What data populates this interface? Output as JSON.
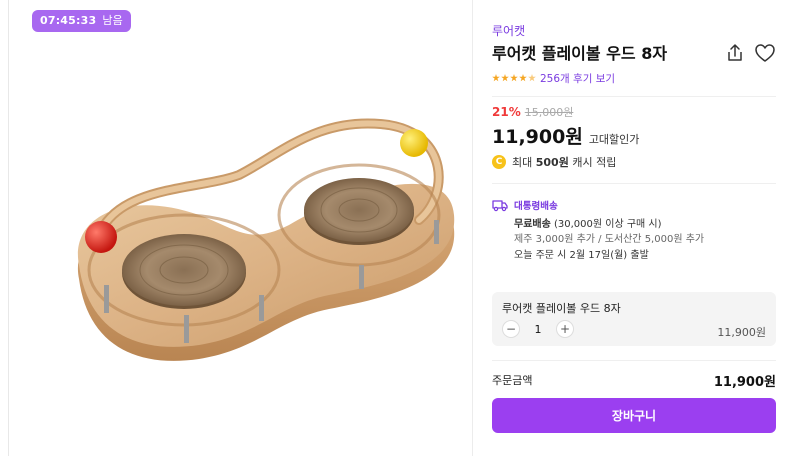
{
  "timer": {
    "time": "07:45:33",
    "suffix": "남음"
  },
  "product": {
    "brand": "루어캣",
    "title": "루어캣 플레이볼 우드 8자",
    "rating": 4.5,
    "review_text": "256개 후기 보기",
    "discount": "21%",
    "original_price": "15,000원",
    "price": "11,900원",
    "price_label": "고대할인가",
    "cash": {
      "prefix": "최대 ",
      "amount": "500원",
      "suffix": " 캐시 적립",
      "icon_char": "C"
    }
  },
  "shipping": {
    "header": "대통령배송",
    "line1_bold": "무료배송",
    "line1_rest": " (30,000원 이상 구매 시)",
    "line2": "제주 3,000원 추가 / 도서산간 5,000원 추가",
    "line3": "오늘 주문 시 2월 17일(월) 출발"
  },
  "option": {
    "name": "루어캣 플레이볼 우드 8자",
    "quantity": "1",
    "minus": "−",
    "plus": "+",
    "price": "11,900원"
  },
  "total": {
    "label": "주문금액",
    "value": "11,900원"
  },
  "cart_button": "장바구니",
  "icons": {
    "share": "share-icon",
    "like": "heart-icon",
    "truck": "truck-icon",
    "coin": "coin-icon"
  },
  "colors": {
    "accent": "#9b3ff0",
    "discount": "#f03a3a",
    "star": "#f5a623",
    "timer": "#a868f0"
  }
}
